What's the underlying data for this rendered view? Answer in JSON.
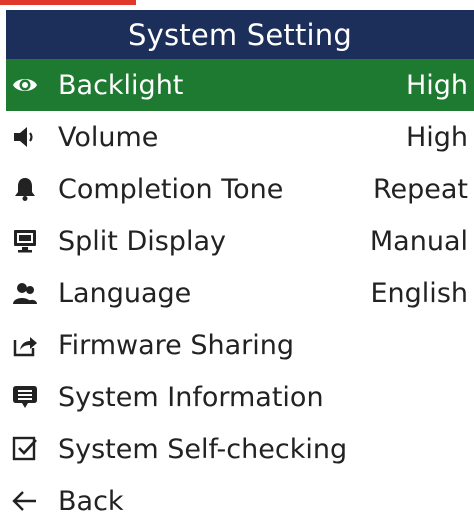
{
  "screen": {
    "title": "System Setting",
    "accent_color": "#e0392b",
    "header_color": "#1c2f5a",
    "selected_color": "#1e7a30"
  },
  "menu": {
    "items": [
      {
        "icon": "eye-icon",
        "label": "Backlight",
        "value": "High",
        "selected": true
      },
      {
        "icon": "speaker-icon",
        "label": "Volume",
        "value": "High",
        "selected": false
      },
      {
        "icon": "bell-icon",
        "label": "Completion Tone",
        "value": "Repeat",
        "selected": false
      },
      {
        "icon": "monitor-icon",
        "label": "Split Display",
        "value": "Manual",
        "selected": false
      },
      {
        "icon": "users-icon",
        "label": "Language",
        "value": "English",
        "selected": false
      },
      {
        "icon": "share-icon",
        "label": "Firmware Sharing",
        "value": "",
        "selected": false
      },
      {
        "icon": "message-icon",
        "label": "System Information",
        "value": "",
        "selected": false
      },
      {
        "icon": "checkbox-icon",
        "label": "System Self-checking",
        "value": "",
        "selected": false
      },
      {
        "icon": "arrow-left-icon",
        "label": "Back",
        "value": "",
        "selected": false
      }
    ]
  }
}
